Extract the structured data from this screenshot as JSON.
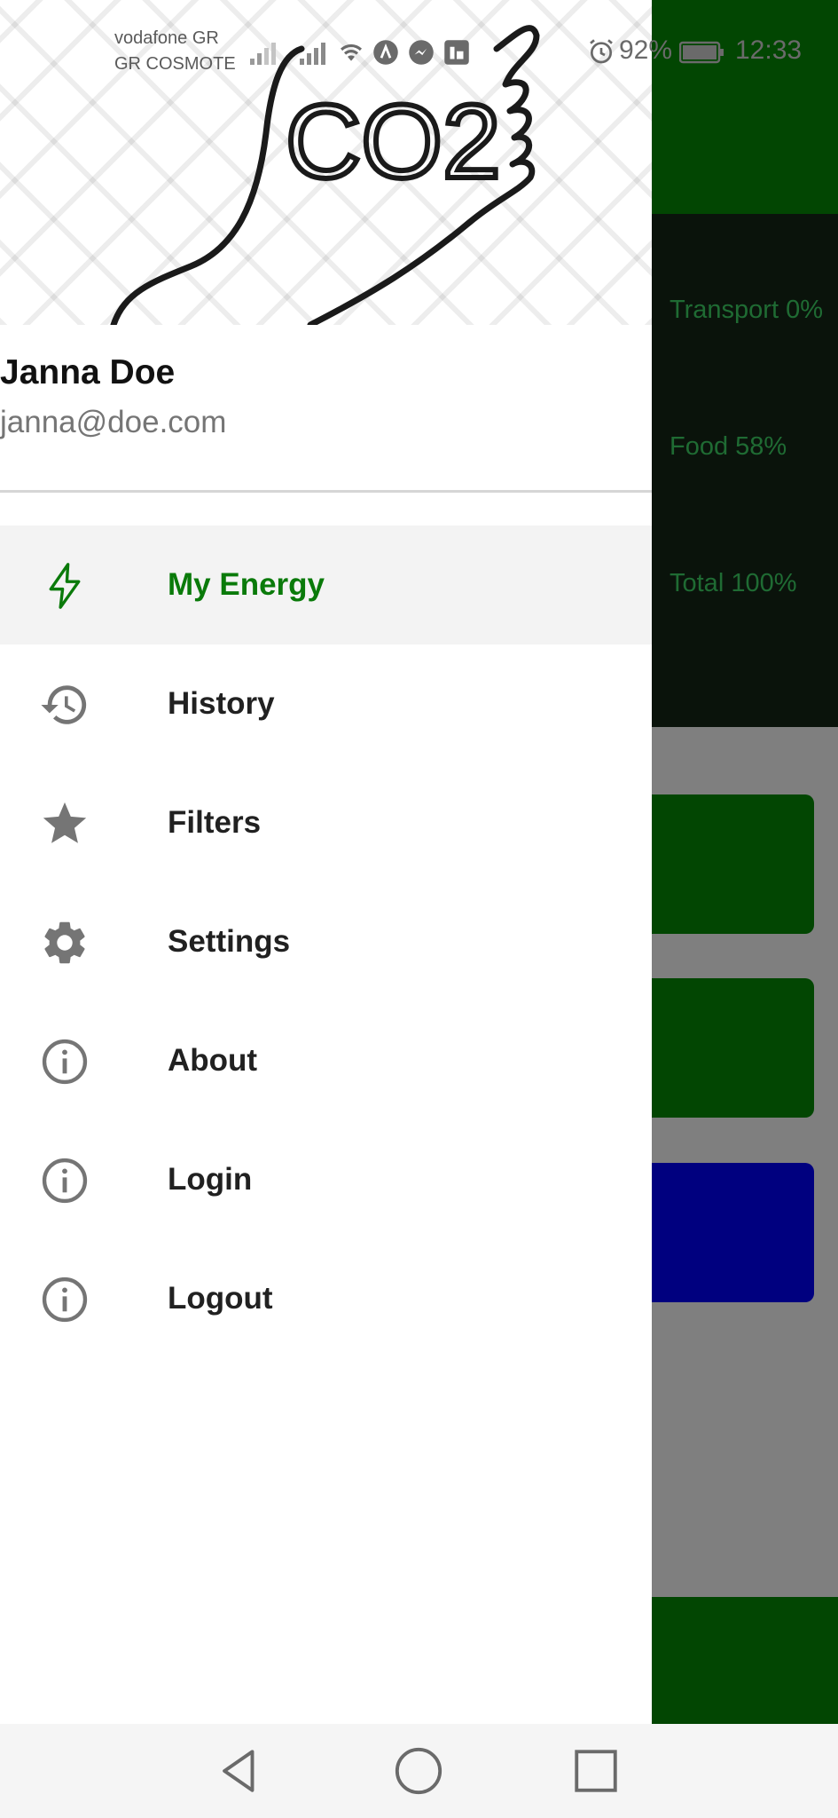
{
  "status_bar": {
    "carrier_1": "vodafone GR",
    "carrier_2": "GR COSMOTE",
    "battery": "92%",
    "time": "12:33",
    "icons": [
      "signal-icon",
      "signal-icon",
      "wifi-icon",
      "app-icon",
      "messenger-icon",
      "app-icon",
      "alarm-icon",
      "battery-icon"
    ]
  },
  "background_app": {
    "stats": [
      "Transport 0%",
      "Food 58%",
      "Total 100%"
    ],
    "colors": {
      "green": "#024602",
      "blue": "#00007f"
    }
  },
  "drawer": {
    "header_logo_text": "CO2",
    "user": {
      "name": "Janna Doe",
      "email": "janna@doe.com"
    },
    "items": [
      {
        "label": "My Energy",
        "icon": "lightning-icon",
        "active": true
      },
      {
        "label": "History",
        "icon": "history-icon"
      },
      {
        "label": "Filters",
        "icon": "star-icon"
      },
      {
        "label": "Settings",
        "icon": "gear-icon"
      },
      {
        "label": "About",
        "icon": "info-icon"
      },
      {
        "label": "Login",
        "icon": "info-icon"
      },
      {
        "label": "Logout",
        "icon": "info-icon"
      }
    ],
    "colors": {
      "active": "#0a7a0a",
      "icon": "#757575"
    }
  },
  "nav_bar": {
    "icons": [
      "back-icon",
      "home-icon",
      "recents-icon"
    ]
  }
}
